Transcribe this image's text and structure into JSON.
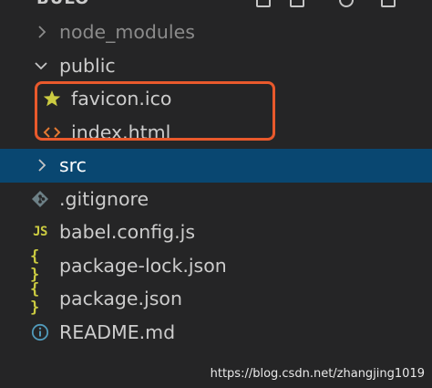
{
  "explorer": {
    "title": "BULO",
    "actions": [
      {
        "name": "new-file-icon"
      },
      {
        "name": "new-folder-icon"
      },
      {
        "name": "refresh-icon"
      },
      {
        "name": "collapse-all-icon"
      }
    ]
  },
  "tree": {
    "node_modules": {
      "label": "node_modules",
      "expanded": false
    },
    "public": {
      "label": "public",
      "expanded": true
    },
    "favicon": {
      "label": "favicon.ico",
      "icon": "star-icon"
    },
    "index": {
      "label": "index.html",
      "icon": "html-icon"
    },
    "src": {
      "label": "src",
      "expanded": false,
      "selected": true
    },
    "gitignore": {
      "label": ".gitignore",
      "icon": "git-icon"
    },
    "babel": {
      "label": "babel.config.js",
      "icon_text": "JS"
    },
    "package_lock": {
      "label": "package-lock.json",
      "icon_text": "{ }"
    },
    "package": {
      "label": "package.json",
      "icon_text": "{ }"
    },
    "readme": {
      "label": "README.md",
      "icon": "info-icon"
    }
  },
  "annotation": {
    "color": "#e9592c"
  },
  "colors": {
    "background": "#252526",
    "selected_row": "#094771",
    "text": "#cccccc",
    "star": "#cbcb41",
    "html": "#e37933",
    "info": "#519aba",
    "git": "#6d8086"
  },
  "watermark": "https://blog.csdn.net/zhangjing1019"
}
